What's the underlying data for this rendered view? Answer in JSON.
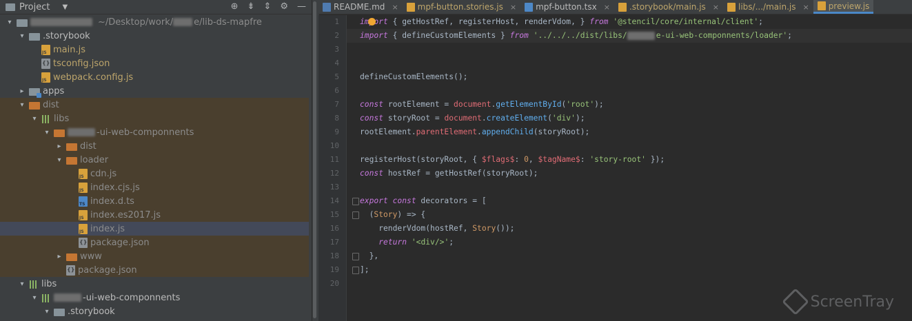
{
  "project": {
    "title": "Project",
    "root_path": "~/Desktop/work/",
    "root_path_tail": "e/lib-ds-mapfre"
  },
  "tree": [
    {
      "label": "",
      "kind": "root",
      "indent": 0,
      "arrow": "▾",
      "icon": "folder",
      "note": "~/Desktop/work/",
      "note2": "e/lib-ds-mapfre"
    },
    {
      "label": ".storybook",
      "indent": 1,
      "arrow": "▾",
      "icon": "folder"
    },
    {
      "label": "main.js",
      "indent": 2,
      "arrow": "",
      "icon": "js",
      "color": "yellow"
    },
    {
      "label": "tsconfig.json",
      "indent": 2,
      "arrow": "",
      "icon": "json",
      "color": "yellow"
    },
    {
      "label": "webpack.config.js",
      "indent": 2,
      "arrow": "",
      "icon": "js",
      "color": "yellow"
    },
    {
      "label": "apps",
      "indent": 1,
      "arrow": "▸",
      "icon": "apps"
    },
    {
      "label": "dist",
      "indent": 1,
      "arrow": "▾",
      "icon": "folder-orange",
      "excluded": true,
      "color": "dim"
    },
    {
      "label": "libs",
      "indent": 2,
      "arrow": "▾",
      "icon": "lib",
      "excluded": true,
      "color": "dim"
    },
    {
      "label": "-ui-web-componnents",
      "indent": 3,
      "arrow": "▾",
      "icon": "folder-orange",
      "excluded": true,
      "color": "dim",
      "blur": true
    },
    {
      "label": "dist",
      "indent": 4,
      "arrow": "▸",
      "icon": "folder-orange",
      "excluded": true,
      "color": "dim"
    },
    {
      "label": "loader",
      "indent": 4,
      "arrow": "▾",
      "icon": "folder-orange",
      "excluded": true,
      "color": "dim"
    },
    {
      "label": "cdn.js",
      "indent": 5,
      "arrow": "",
      "icon": "js",
      "excluded": true,
      "color": "dim"
    },
    {
      "label": "index.cjs.js",
      "indent": 5,
      "arrow": "",
      "icon": "js",
      "excluded": true,
      "color": "dim"
    },
    {
      "label": "index.d.ts",
      "indent": 5,
      "arrow": "",
      "icon": "ts",
      "excluded": true,
      "color": "dim"
    },
    {
      "label": "index.es2017.js",
      "indent": 5,
      "arrow": "",
      "icon": "js",
      "excluded": true,
      "color": "dim"
    },
    {
      "label": "index.js",
      "indent": 5,
      "arrow": "",
      "icon": "js",
      "selected": true,
      "color": "dim"
    },
    {
      "label": "package.json",
      "indent": 5,
      "arrow": "",
      "icon": "json",
      "excluded": true,
      "color": "dim"
    },
    {
      "label": "www",
      "indent": 4,
      "arrow": "▸",
      "icon": "folder-orange",
      "excluded": true,
      "color": "dim"
    },
    {
      "label": "package.json",
      "indent": 4,
      "arrow": "",
      "icon": "json",
      "excluded": true,
      "color": "dim"
    },
    {
      "label": "libs",
      "indent": 1,
      "arrow": "▾",
      "icon": "lib"
    },
    {
      "label": "-ui-web-componnents",
      "indent": 2,
      "arrow": "▾",
      "icon": "lib",
      "blur": true
    },
    {
      "label": ".storybook",
      "indent": 3,
      "arrow": "▾",
      "icon": "folder"
    }
  ],
  "tabs": [
    {
      "label": "README.md",
      "icon": "md",
      "active": false,
      "color": "",
      "close": "×"
    },
    {
      "label": "mpf-button.stories.js",
      "icon": "js",
      "active": false,
      "color": "yellow",
      "close": "×"
    },
    {
      "label": "mpf-button.tsx",
      "icon": "tsx",
      "active": false,
      "color": "",
      "close": "×"
    },
    {
      "label": ".storybook/main.js",
      "icon": "js",
      "active": false,
      "color": "yellow",
      "close": "×"
    },
    {
      "label": "libs/.../main.js",
      "icon": "js",
      "active": false,
      "color": "yellow",
      "close": "×"
    },
    {
      "label": "preview.js",
      "icon": "js",
      "active": true,
      "color": "yellow",
      "close": ""
    }
  ],
  "line_numbers": [
    "1",
    "2",
    "3",
    "4",
    "5",
    "6",
    "7",
    "8",
    "9",
    "10",
    "11",
    "12",
    "13",
    "14",
    "15",
    "16",
    "17",
    "18",
    "19",
    "20"
  ],
  "code": [
    [
      [
        "k",
        "import"
      ],
      [
        "p",
        " { getHostRef, registerHost, renderVdom, } "
      ],
      [
        "k",
        "from"
      ],
      [
        "p",
        " "
      ],
      [
        "s",
        "'@stencil/core/internal/client'"
      ],
      [
        "p",
        ";"
      ]
    ],
    [
      [
        "k",
        "import"
      ],
      [
        "p",
        " { defineCustomElements } "
      ],
      [
        "k",
        "from"
      ],
      [
        "p",
        " "
      ],
      [
        "s",
        "'../../../dist/libs/"
      ],
      [
        "b",
        ""
      ],
      [
        "s",
        "e-ui-web-componnents/loader'"
      ],
      [
        "p",
        ";"
      ]
    ],
    [],
    [],
    [
      [
        "p",
        "defineCustomElements();"
      ]
    ],
    [],
    [
      [
        "k",
        "const"
      ],
      [
        "p",
        " rootElement = "
      ],
      [
        "gv",
        "document"
      ],
      [
        "p",
        "."
      ],
      [
        "fn",
        "getElementById"
      ],
      [
        "p",
        "("
      ],
      [
        "s",
        "'root'"
      ],
      [
        "p",
        ");"
      ]
    ],
    [
      [
        "k",
        "const"
      ],
      [
        "p",
        " storyRoot = "
      ],
      [
        "gv",
        "document"
      ],
      [
        "p",
        "."
      ],
      [
        "fn",
        "createElement"
      ],
      [
        "p",
        "("
      ],
      [
        "s",
        "'div'"
      ],
      [
        "p",
        ");"
      ]
    ],
    [
      [
        "p",
        "rootElement."
      ],
      [
        "prop",
        "parentElement"
      ],
      [
        "p",
        "."
      ],
      [
        "fn",
        "appendChild"
      ],
      [
        "p",
        "(storyRoot);"
      ]
    ],
    [],
    [
      [
        "p",
        "registerHost(storyRoot, { "
      ],
      [
        "prop",
        "$flags$"
      ],
      [
        "p",
        ": "
      ],
      [
        "num",
        "0"
      ],
      [
        "p",
        ", "
      ],
      [
        "prop",
        "$tagName$"
      ],
      [
        "p",
        ": "
      ],
      [
        "s",
        "'story-root'"
      ],
      [
        "p",
        " });"
      ]
    ],
    [
      [
        "k",
        "const"
      ],
      [
        "p",
        " hostRef = getHostRef(storyRoot);"
      ]
    ],
    [],
    [
      [
        "k",
        "export const"
      ],
      [
        "p",
        " decorators = ["
      ]
    ],
    [
      [
        "p",
        "  ("
      ],
      [
        "num",
        "Story"
      ],
      [
        "p",
        ") => {"
      ]
    ],
    [
      [
        "p",
        "    renderVdom(hostRef, "
      ],
      [
        "num",
        "Story"
      ],
      [
        "p",
        "());"
      ]
    ],
    [
      [
        "p",
        "    "
      ],
      [
        "k",
        "return"
      ],
      [
        "p",
        " "
      ],
      [
        "s",
        "'<div/>'"
      ],
      [
        "p",
        ";"
      ]
    ],
    [
      [
        "p",
        "  },"
      ]
    ],
    [
      [
        "p",
        "];"
      ]
    ],
    []
  ],
  "watermark": "ScreenTray",
  "icons": {
    "header": [
      "target-icon",
      "collapse-all-icon",
      "expand-icon",
      "settings-icon",
      "hide-icon"
    ]
  },
  "colors": {
    "accent": "#4a88c7",
    "excluded_bg": "#4a3f2e",
    "selected_bg": "#434959"
  }
}
